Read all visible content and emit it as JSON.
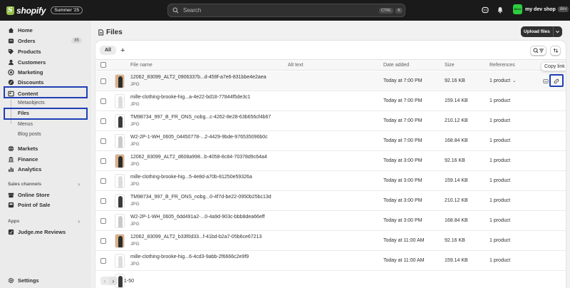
{
  "topbar": {
    "logo_text": "shopify",
    "edition": "Summer '25",
    "search_placeholder": "Search",
    "kbd_ctrl": "CTRL",
    "kbd_k": "K",
    "store_avatar": "Store",
    "store_name": "my dev shop",
    "store_badge": "dev"
  },
  "sidebar": {
    "home": "Home",
    "orders": "Orders",
    "orders_count": "85",
    "products": "Products",
    "customers": "Customers",
    "marketing": "Marketing",
    "discounts": "Discounts",
    "content": "Content",
    "metaobjects": "Metaobjects",
    "files": "Files",
    "menus": "Menus",
    "blog_posts": "Blog posts",
    "markets": "Markets",
    "finance": "Finance",
    "analytics": "Analytics",
    "sales_channels": "Sales channels",
    "online_store": "Online Store",
    "point_of_sale": "Point of Sale",
    "apps": "Apps",
    "judge_me": "Judge.me Reviews",
    "settings": "Settings"
  },
  "page": {
    "title": "Files",
    "upload_label": "Upload files"
  },
  "tabs": {
    "all": "All",
    "add": "+"
  },
  "table": {
    "headers": {
      "file_name": "File name",
      "alt_text": "Alt text",
      "date_added": "Date added",
      "size": "Size",
      "references": "References"
    },
    "rows": [
      {
        "name": "12062_83099_ALT2_0906337b...d-459f-a7e6-831bbe4e2aea",
        "type": "JPG",
        "date": "Today at 7:00 PM",
        "size": "92.16 KB",
        "refs": "1 product",
        "thumb": "brown",
        "fig": "#2b2b2b"
      },
      {
        "name": "mille-clothing-brooke-hig...a-4e22-bd18-77844f5de3c1",
        "type": "JPG",
        "date": "Today at 7:00 PM",
        "size": "159.14 KB",
        "refs": "1 product",
        "thumb": "white",
        "fig": "#dcdcdc"
      },
      {
        "name": "TM98734_997_B_FR_ONS_nobg...c-4262-8e28-63b656cf4b67",
        "type": "JPG",
        "date": "Today at 7:00 PM",
        "size": "210.12 KB",
        "refs": "1 product",
        "thumb": "white",
        "fig": "#3a3a3a"
      },
      {
        "name": "W2-2P-1-WH_0605_04450778-...2-4429-9bde-976535096b0c",
        "type": "JPG",
        "date": "Today at 7:00 PM",
        "size": "168.84 KB",
        "refs": "1 product",
        "thumb": "white",
        "fig": "#c9c9c9"
      },
      {
        "name": "12062_83099_ALT2_d608a998...b-4058-8c84-70378d9c64a4",
        "type": "JPG",
        "date": "Today at 3:00 PM",
        "size": "92.16 KB",
        "refs": "1 product",
        "thumb": "brown",
        "fig": "#2b2b2b"
      },
      {
        "name": "mille-clothing-brooke-hig...5-4e8d-a70b-81250e59326a",
        "type": "JPG",
        "date": "Today at 3:00 PM",
        "size": "159.14 KB",
        "refs": "1 product",
        "thumb": "white",
        "fig": "#dcdcdc"
      },
      {
        "name": "TM98734_997_B_FR_ONS_nobg...0-4f7d-be22-0950b25bc13d",
        "type": "JPG",
        "date": "Today at 3:00 PM",
        "size": "210.12 KB",
        "refs": "1 product",
        "thumb": "white",
        "fig": "#3a3a3a"
      },
      {
        "name": "W2-2P-1-WH_0605_6dd491a2-...0-4a9d-903c-bbb8dea66eff",
        "type": "JPG",
        "date": "Today at 3:00 PM",
        "size": "168.84 KB",
        "refs": "1 product",
        "thumb": "white",
        "fig": "#c9c9c9"
      },
      {
        "name": "12062_83099_ALT2_b33f0d33...f-41bd-b2a7-05b6ce67213",
        "type": "JPG",
        "date": "Today at 11:00 AM",
        "size": "92.16 KB",
        "refs": "1 product",
        "thumb": "brown",
        "fig": "#2b2b2b"
      },
      {
        "name": "mille-clothing-brooke-hig...6-4cd3-9abb-2f6666c2e9f9",
        "type": "JPG",
        "date": "Today at 11:00 AM",
        "size": "159.14 KB",
        "refs": "1 product",
        "thumb": "white",
        "fig": "#dcdcdc"
      },
      {
        "name": "",
        "type": "",
        "date": "",
        "size": "",
        "refs": "",
        "thumb": "white",
        "fig": "#3a3a3a"
      }
    ]
  },
  "tooltip": "Copy link",
  "pager": {
    "prev": "‹",
    "next": "›",
    "range": "1-50"
  }
}
